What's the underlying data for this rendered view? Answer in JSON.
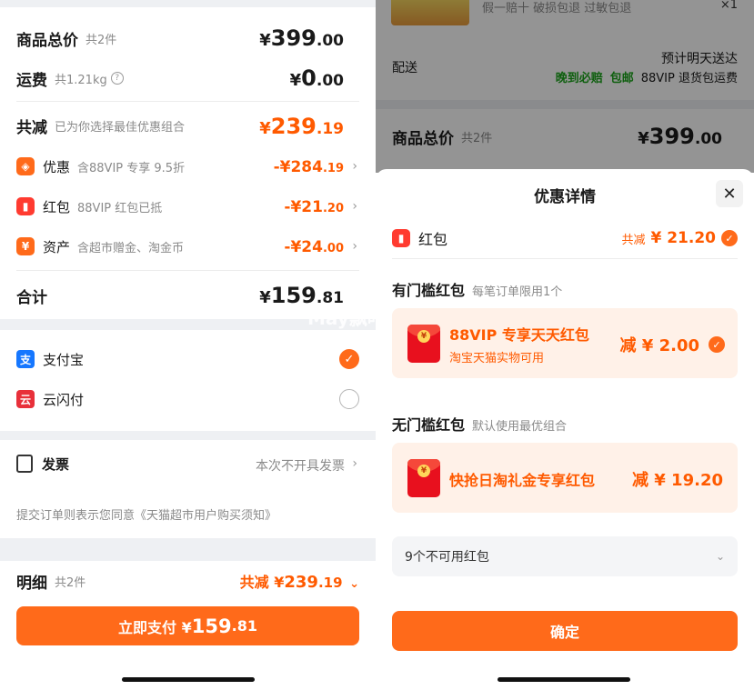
{
  "left": {
    "goods_total": {
      "label": "商品总价",
      "sub": "共2件",
      "yen": "¥",
      "int": "399",
      "dec": ".00"
    },
    "shipping": {
      "label": "运费",
      "sub": "共1.21kg",
      "help_icon": "help-circle-icon",
      "yen": "¥",
      "int": "0",
      "dec": ".00"
    },
    "total_discount": {
      "label": "共减",
      "sub": "已为你选择最佳优惠组合",
      "yen": "¥",
      "int": "239",
      "dec": ".19"
    },
    "discounts": [
      {
        "icon": "tag-icon",
        "glyph": "◈",
        "label": "优惠",
        "sub": "含88VIP 专享 9.5折",
        "val_int": "-¥284",
        "val_dec": ".19"
      },
      {
        "icon": "red-packet-icon",
        "glyph": "▮",
        "label": "红包",
        "sub": "88VIP 红包已抵",
        "val_int": "-¥21",
        "val_dec": ".20"
      },
      {
        "icon": "assets-yen-icon",
        "glyph": "¥",
        "label": "资产",
        "sub": "含超市赠金、淘金币",
        "val_int": "-¥24",
        "val_dec": ".00"
      }
    ],
    "subtotal": {
      "label": "合计",
      "yen": "¥",
      "int": "159",
      "dec": ".81"
    },
    "payments": [
      {
        "icon": "alipay-icon",
        "glyph": "支",
        "label": "支付宝",
        "selected": true
      },
      {
        "icon": "unionpay-quickpass-icon",
        "glyph": "云",
        "label": "云闪付",
        "selected": false
      }
    ],
    "invoice": {
      "label": "发票",
      "value": "本次不开具发票"
    },
    "agreement": "提交订单则表示您同意《天猫超市用户购买须知》",
    "detail": {
      "label": "明细",
      "sub": "共2件",
      "saved_prefix": "共减 ¥",
      "saved_int": "239",
      "saved_dec": ".19"
    },
    "pay_button": {
      "label": "立即支付 ¥",
      "int": "159",
      "dec": ".81"
    }
  },
  "right_bg": {
    "top_tags": "假一赔十  破损包退  过敏包退",
    "qty": "×1",
    "shipping_label": "配送",
    "shipping_eta": "预计明天送达",
    "shipping_tags": [
      "晚到必赔",
      "包邮"
    ],
    "shipping_vip": "88VIP 退货包运费",
    "goods_total": {
      "label": "商品总价",
      "sub": "共2件",
      "yen": "¥",
      "int": "399",
      "dec": ".00"
    }
  },
  "sheet": {
    "title": "优惠详情",
    "section": {
      "icon": "red-packet-icon",
      "label": "红包",
      "saved_prefix": "共减",
      "saved_value": "¥ 21.20"
    },
    "threshold": {
      "label": "有门槛红包",
      "sub": "每笔订单限用1个"
    },
    "coupon_1": {
      "title": "88VIP 专享天天红包",
      "sub": "淘宝天猫实物可用",
      "value": "减 ¥ 2.00"
    },
    "no_threshold": {
      "label": "无门槛红包",
      "sub": "默认使用最优组合"
    },
    "coupon_2": {
      "title": "快抢日淘礼金专享红包",
      "value": "减 ¥ 19.20"
    },
    "unavailable": "9个不可用红包",
    "confirm": "确定"
  },
  "watermark": "May飘叶",
  "colors": {
    "accent": "#ff6a1a",
    "price": "#ff5a00",
    "green": "#1aa41a",
    "alipay": "#1677ff",
    "unionpay": "#e8303a"
  }
}
